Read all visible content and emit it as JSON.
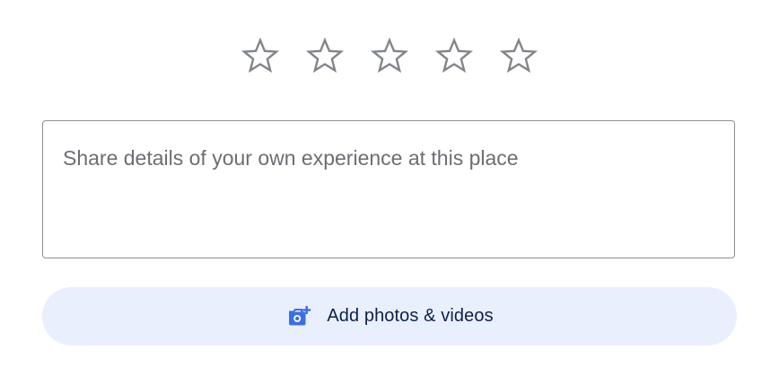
{
  "rating": {
    "max_stars": 5,
    "selected": 0,
    "star_color": "#818589"
  },
  "review": {
    "placeholder": "Share details of your own experience at this place",
    "value": ""
  },
  "add_media": {
    "label": "Add photos & videos",
    "icon": "add-photo-camera-icon",
    "icon_color": "#3b6fe0",
    "background": "#e9effd"
  }
}
